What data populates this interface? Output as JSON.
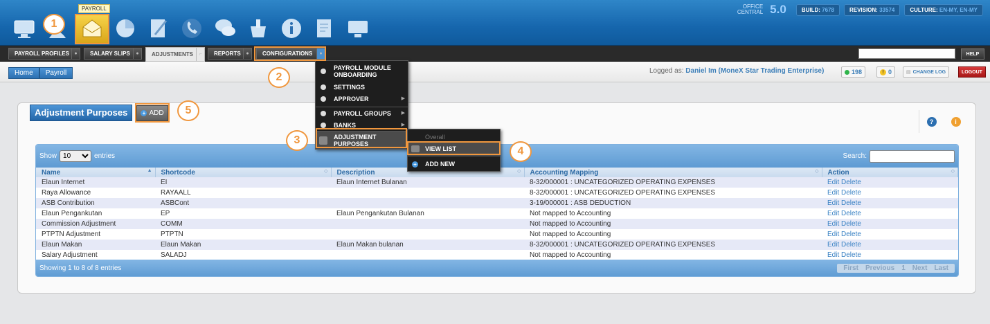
{
  "top": {
    "icons": [
      "monitor-icon",
      "people-icon",
      "envelope-icon",
      "pie-chart-icon",
      "pen-icon",
      "phone-icon",
      "chat-icon",
      "basket-icon",
      "info-icon",
      "notepad-icon",
      "monitor2-icon"
    ],
    "active_tooltip": "PAYROLL",
    "brand_line1": "OFFICE",
    "brand_line2": "CENTRAL",
    "version": "5.0",
    "build_label": "BUILD:",
    "build_value": "7678",
    "revision_label": "REVISION:",
    "revision_value": "33574",
    "culture_label": "CULTURE:",
    "culture_value": "EN-MY, EN-MY"
  },
  "nav": {
    "tabs": [
      "PAYROLL PROFILES",
      "SALARY SLIPS",
      "ADJUSTMENTS",
      "REPORTS",
      "CONFIGURATIONS"
    ],
    "help": "HELP"
  },
  "breadcrumb": {
    "home": "Home",
    "current": "Payroll"
  },
  "user": {
    "logged_as": "Logged as:",
    "name": "Daniel Im (MoneX Star Trading Enterprise)",
    "online_count": "198",
    "alert_count": "0",
    "change_log": "CHANGE LOG",
    "logout": "LOGOUT"
  },
  "panel": {
    "title": "Adjustment Purposes",
    "add": "ADD"
  },
  "grid": {
    "show": "Show",
    "entries_value": "10",
    "entries": "entries",
    "search_label": "Search:",
    "columns": [
      "Name",
      "Shortcode",
      "Description",
      "Accounting Mapping",
      "Action"
    ],
    "rows": [
      [
        "Elaun Internet",
        "EI",
        "Elaun Internet Bulanan",
        "8-32/000001 : UNCATEGORIZED OPERATING EXPENSES"
      ],
      [
        "Raya Allowance",
        "RAYAALL",
        "",
        "8-32/000001 : UNCATEGORIZED OPERATING EXPENSES"
      ],
      [
        "ASB Contribution",
        "ASBCont",
        "",
        "3-19/000001 : ASB DEDUCTION"
      ],
      [
        "Elaun Pengankutan",
        "EP",
        "Elaun Pengankutan Bulanan",
        "Not mapped to Accounting"
      ],
      [
        "Commission Adjustment",
        "COMM",
        "",
        "Not mapped to Accounting"
      ],
      [
        "PTPTN Adjustment",
        "PTPTN",
        "",
        "Not mapped to Accounting"
      ],
      [
        "Elaun Makan",
        "Elaun Makan",
        "Elaun Makan bulanan",
        "8-32/000001 : UNCATEGORIZED OPERATING EXPENSES"
      ],
      [
        "Salary Adjustment",
        "SALADJ",
        "",
        "Not mapped to Accounting"
      ]
    ],
    "edit": "Edit",
    "delete": "Delete",
    "info": "Showing 1 to 8 of 8 entries",
    "pager": [
      "First",
      "Previous",
      "1",
      "Next",
      "Last"
    ]
  },
  "menu": {
    "items": [
      "PAYROLL MODULE ONBOARDING",
      "SETTINGS",
      "APPROVER",
      "PAYROLL GROUPS",
      "BANKS",
      "ADJUSTMENT PURPOSES"
    ],
    "sub_items": [
      "Overall",
      "VIEW LIST",
      "ADD NEW"
    ]
  },
  "callouts": [
    "1",
    "2",
    "3",
    "4",
    "5"
  ]
}
